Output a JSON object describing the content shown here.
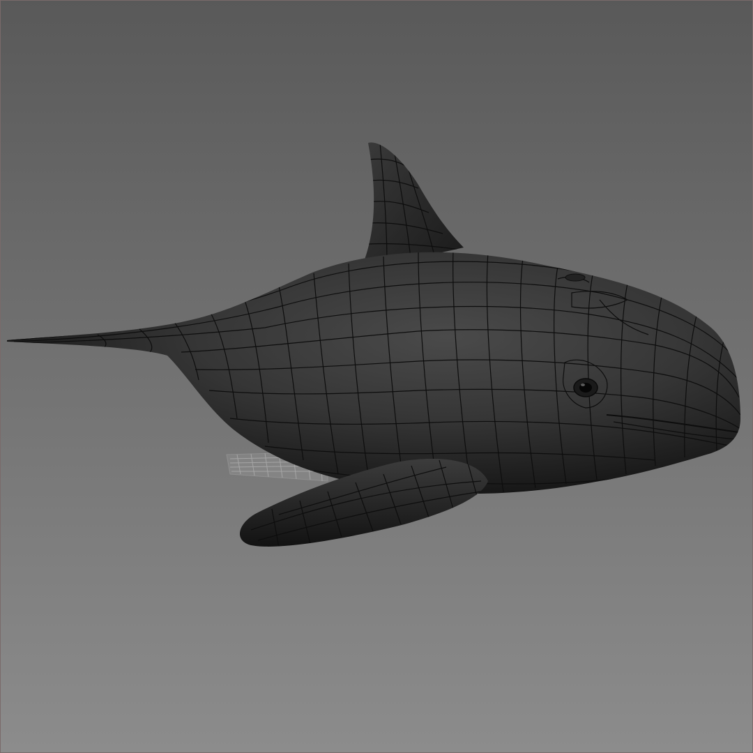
{
  "viewport": {
    "background_top": "#595959",
    "background_bottom": "#8c8c8c",
    "border_color": "#7a6a6a"
  },
  "model": {
    "subject": "dolphin-mesh",
    "shading_color": "#2f2f2f",
    "wire_color": "#0d0d0d",
    "display_mode": "wireframe-on-shaded"
  }
}
